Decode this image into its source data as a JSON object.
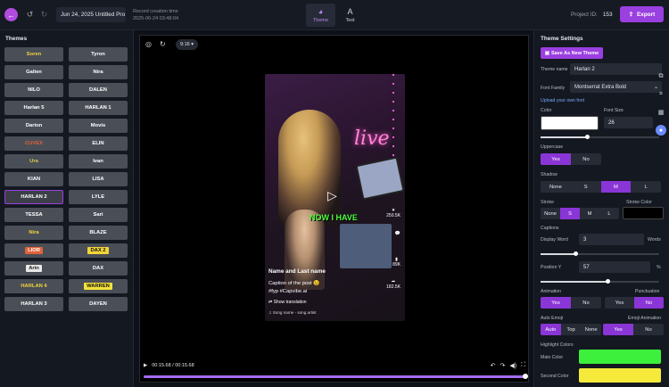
{
  "topbar": {
    "project_title": "Jun 24, 2025 Untitled Pro",
    "creation_label": "Record creation time",
    "creation_time": "2025-06-24 03:48:04",
    "tabs": [
      {
        "label": "Theme",
        "active": true
      },
      {
        "label": "Text",
        "active": false
      }
    ],
    "project_id_label": "Project ID:",
    "project_id": "153",
    "export_label": "Export"
  },
  "themes": {
    "title": "Themes",
    "items": [
      {
        "label": "Soren",
        "color": "#f2d43a"
      },
      {
        "label": "Tyron",
        "color": "#ffffff"
      },
      {
        "label": "Galien",
        "color": "#ffffff"
      },
      {
        "label": "Nira",
        "color": "#ffffff"
      },
      {
        "label": "NILO",
        "color": "#ffffff"
      },
      {
        "label": "DALEN",
        "color": "#ffffff"
      },
      {
        "label": "Harlan 5",
        "color": "#ffffff"
      },
      {
        "label": "HARLAN 1",
        "color": "#ffffff"
      },
      {
        "label": "Darion",
        "color": "#ffffff"
      },
      {
        "label": "Movis",
        "color": "#ffffff"
      },
      {
        "label": "CUVEX",
        "color": "#e0623a"
      },
      {
        "label": "ELIN",
        "color": "#ffffff"
      },
      {
        "label": "Ura",
        "color": "#d9c64a"
      },
      {
        "label": "Ivan",
        "color": "#ffffff"
      },
      {
        "label": "KIAN",
        "color": "#ffffff"
      },
      {
        "label": "LISA",
        "color": "#ffffff"
      },
      {
        "label": "HARLAN 2",
        "color": "#ffffff",
        "selected": true
      },
      {
        "label": "LYLE",
        "color": "#ffffff"
      },
      {
        "label": "TESSA",
        "color": "#ffffff"
      },
      {
        "label": "Sari",
        "color": "#ffffff"
      },
      {
        "label": "Nira",
        "color": "#f2d43a"
      },
      {
        "label": "BLAZE",
        "color": "#ffffff"
      },
      {
        "label": "LIOR",
        "color": "#ffffff",
        "bg": "#e0623a"
      },
      {
        "label": "DAX 2",
        "color": "#111111",
        "bg": "#f2d43a"
      },
      {
        "label": "Arin",
        "color": "#222222",
        "bg": "#e8e8e8"
      },
      {
        "label": "DAX",
        "color": "#ffffff"
      },
      {
        "label": "HARLAN 4",
        "color": "#f2d43a"
      },
      {
        "label": "WARREN",
        "color": "#111111",
        "bg": "#f2e23a"
      },
      {
        "label": "HARLAN 3",
        "color": "#ffffff"
      },
      {
        "label": "DAYEN",
        "color": "#ffffff"
      }
    ]
  },
  "player": {
    "ratio": "9:16",
    "overlay_text": "NOW I HAVE",
    "neon": "live",
    "likes": "250.5K",
    "comments": "89K",
    "shares": "182.5K",
    "caption_name": "Name and Last name",
    "caption_line1": "Caption of the post 😉",
    "caption_line2": "#fyp #Capvibe.ai",
    "show_translation": "Show translation",
    "song": "Song name - song artist",
    "time": "00:15.68 / 00:15.68",
    "progress": 1.0
  },
  "settings": {
    "title": "Theme Settings",
    "save_label": "Save As New Theme",
    "theme_name_label": "Theme name",
    "theme_name": "Harlan 2",
    "font_family_label": "Font Family",
    "font_family": "Montserrat Extra Bold",
    "upload_font": "Upload your own font",
    "color_label": "Color",
    "font_size_label": "Font Size",
    "font_size": "26",
    "color": "#ffffff",
    "color_slider": 0.4,
    "uppercase_label": "Uppercase",
    "uppercase": [
      "Yes",
      "No"
    ],
    "shadow_label": "Shadow",
    "shadow": [
      "None",
      "S",
      "M",
      "L"
    ],
    "stroke_label": "Stroke",
    "stroke_color_label": "Stroke Color",
    "stroke": [
      "None",
      "S",
      "M",
      "L"
    ],
    "stroke_color": "#000000",
    "captions_label": "Captions",
    "display_word_label": "Display Word",
    "display_word": "3",
    "words_label": "Words",
    "display_slider": 0.3,
    "position_y_label": "Position Y",
    "position_y": "57",
    "percent": "%",
    "position_slider": 0.57,
    "animation_label": "Animation",
    "punctuation_label": "Punctuation",
    "animation": [
      "Yes",
      "No"
    ],
    "punctuation": [
      "Yes",
      "No"
    ],
    "auto_emoji_label": "Auto Emoji",
    "emoji_animation_label": "Emoji Animation",
    "auto_emoji": [
      "Auto",
      "Top",
      "None"
    ],
    "emoji_animation": [
      "Yes",
      "No"
    ],
    "highlight_label": "Highlight Colors",
    "main_color_label": "Main Color",
    "main_color": "#3cf03c",
    "second_color_label": "Second Color",
    "second_color": "#f5e93a"
  }
}
